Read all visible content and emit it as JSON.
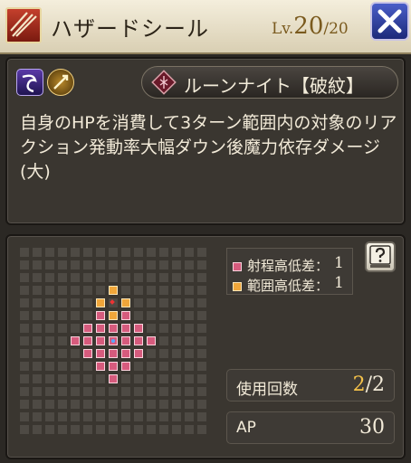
{
  "header": {
    "title": "ハザードシール",
    "level_label": "Lv.",
    "level_current": "20",
    "level_sep": "/",
    "level_max": "20",
    "close_icon": "close-x-icon"
  },
  "info": {
    "element_icons": [
      "dark-wave-icon",
      "dagger-slash-icon"
    ],
    "job_icon": "rune-knight-emblem-icon",
    "job_label": "ルーンナイト【破紋】",
    "description": "自身のHPを消費して3ターン範囲内の対象のリアクション発動率大幅ダウン後魔力依存ダメージ(大)"
  },
  "range": {
    "legend": [
      {
        "label": "射程高低差：",
        "value": "1",
        "color": "#d65b7d"
      },
      {
        "label": "範囲高低差：",
        "value": "1",
        "color": "#f0a63a"
      }
    ],
    "help_icon": "question-book-icon",
    "grid_size": 15,
    "center": [
      7,
      7
    ],
    "range_cells": [
      [
        6,
        5
      ],
      [
        7,
        5
      ],
      [
        8,
        5
      ],
      [
        5,
        6
      ],
      [
        6,
        6
      ],
      [
        7,
        6
      ],
      [
        8,
        6
      ],
      [
        9,
        6
      ],
      [
        4,
        7
      ],
      [
        5,
        7
      ],
      [
        6,
        7
      ],
      [
        8,
        7
      ],
      [
        9,
        7
      ],
      [
        10,
        7
      ],
      [
        5,
        8
      ],
      [
        6,
        8
      ],
      [
        7,
        8
      ],
      [
        8,
        8
      ],
      [
        9,
        8
      ],
      [
        6,
        9
      ],
      [
        7,
        9
      ],
      [
        8,
        9
      ],
      [
        7,
        10
      ]
    ],
    "area_cells": [
      [
        7,
        3
      ],
      [
        6,
        4
      ],
      [
        8,
        4
      ],
      [
        7,
        5
      ]
    ],
    "target_cell": [
      7,
      4
    ]
  },
  "stats": {
    "uses_label": "使用回数",
    "uses_current": "2",
    "uses_sep": "/",
    "uses_max": "2",
    "ap_label": "AP",
    "ap_value": "30"
  }
}
